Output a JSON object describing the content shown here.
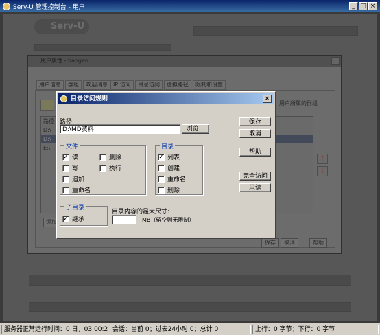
{
  "app": {
    "title": "Serv-U 管理控制台 - 用户",
    "controls": {
      "minimize": "_",
      "maximize": "□",
      "close": "×"
    }
  },
  "background": {
    "logo_text": "Serv-U",
    "user_dialog": {
      "title": "用户属性 - haogen",
      "tabs": [
        "用户信息",
        "群组",
        "欢迎消息",
        "IP 访问",
        "目录访问",
        "虚拟路径",
        "限制和设置"
      ],
      "right_hint": "用户所属的群组",
      "list_header": "路径",
      "list_items": [
        "D:\\",
        "D:\\",
        "E:\\"
      ],
      "add_button": "添加",
      "save_button": "保存",
      "cancel_button": "取消",
      "help_button": "帮助",
      "up_arrow": "↑",
      "down_arrow": "↓"
    }
  },
  "dialog": {
    "title": "目录访问规则",
    "close": "×",
    "path_label": "路径:",
    "path_value": "D:\\MD资料",
    "browse_button": "浏览...",
    "save_button": "保存",
    "cancel_button": "取消",
    "help_button": "帮助",
    "full_access_button": "完全访问",
    "read_only_button": "只读",
    "files_group": {
      "title": "文件",
      "items": [
        {
          "label": "读",
          "checked": true
        },
        {
          "label": "删除",
          "checked": false
        },
        {
          "label": "写",
          "checked": false
        },
        {
          "label": "执行",
          "checked": false
        },
        {
          "label": "追加",
          "checked": false
        },
        {
          "label": "重命名",
          "checked": false
        }
      ]
    },
    "dirs_group": {
      "title": "目录",
      "items": [
        {
          "label": "列表",
          "checked": true
        },
        {
          "label": "创建",
          "checked": false
        },
        {
          "label": "重命名",
          "checked": false
        },
        {
          "label": "删除",
          "checked": false
        }
      ]
    },
    "subdir_group": {
      "title": "子目录",
      "items": [
        {
          "label": "继承",
          "checked": true
        }
      ]
    },
    "max_size_label": "目录内容的最大尺寸:",
    "max_size_value": "",
    "max_size_unit": "MB（留空则无限制）"
  },
  "statusbar": {
    "uptime": "服务器正常运行时间：0 日，03:00:20",
    "sessions": "会话：当前 0；过去24小时 0；总计 0",
    "upload": "上行：0 字节；下行：0 字节"
  },
  "colors": {
    "titlebar": "#0a246a",
    "dialog_face": "#d4d0c8",
    "group_title": "#0033aa"
  }
}
